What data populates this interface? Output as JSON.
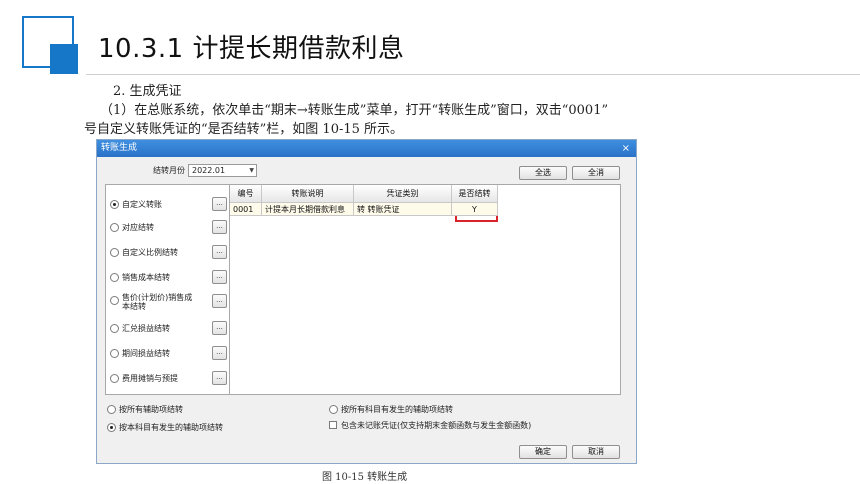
{
  "page": {
    "title": "10.3.1  计提长期借款利息",
    "step": "2.  生成凭证",
    "para_line1": "（1）在总账系统，依次单击“期末→转账生成”菜单，打开“转账生成”窗口，双击“0001”",
    "para_line2": "号自定义转账凭证的“是否结转”栏，如图 10-15 所示。",
    "caption": "图 10-15  转账生成",
    "accent_color": "#1677c9"
  },
  "dialog": {
    "title": "转账生成",
    "close": "×",
    "month_label": "结转月份",
    "month_value": "2022.01",
    "select_all": "全选",
    "clear_all": "全消",
    "ok": "确定",
    "cancel": "取消",
    "ellipsis": "...",
    "options": [
      {
        "label": "自定义转账",
        "selected": true
      },
      {
        "label": "对应结转",
        "selected": false
      },
      {
        "label": "自定义比例结转",
        "selected": false
      },
      {
        "label": "销售成本结转",
        "selected": false
      },
      {
        "label": "售价(计划价)销售成本结转",
        "selected": false
      },
      {
        "label": "汇兑损益结转",
        "selected": false
      },
      {
        "label": "期间损益结转",
        "selected": false
      },
      {
        "label": "费用摊销与预提",
        "selected": false
      }
    ],
    "columns": [
      "编号",
      "转账说明",
      "凭证类别",
      "是否结转"
    ],
    "rows": [
      [
        "0001",
        "计提本月长期借款利息",
        "转 转账凭证",
        "Y"
      ]
    ],
    "bottom_options": {
      "by_aux_all": "按所有辅助项结转",
      "by_account_aux": "按本科目有发生的辅助项结转",
      "by_account_all_aux": "按所有科目有发生的辅助项结转",
      "include_unposted": "包含未记账凭证(仅支持期末金额函数与发生金额函数)"
    }
  },
  "chart_data": {
    "type": "table",
    "title": "",
    "columns": [
      "编号",
      "转账说明",
      "凭证类别",
      "是否结转"
    ],
    "rows": [
      [
        "0001",
        "计提本月长期借款利息",
        "转 转账凭证",
        "Y"
      ]
    ]
  }
}
